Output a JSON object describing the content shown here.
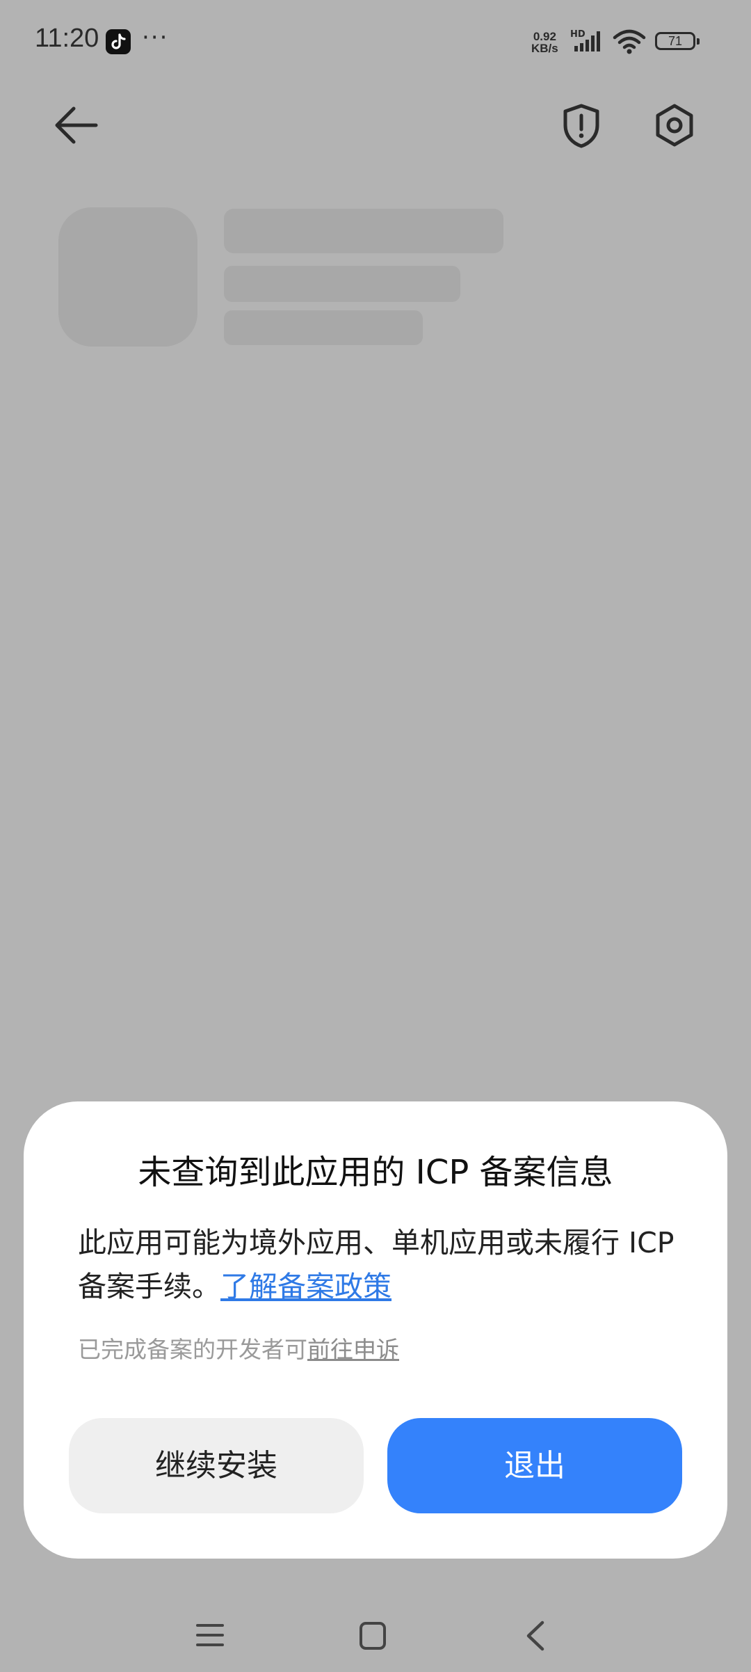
{
  "status_bar": {
    "time": "11:20",
    "more": "···",
    "net_speed_value": "0.92",
    "net_speed_unit": "KB/s",
    "hd": "HD",
    "battery": "71"
  },
  "dialog": {
    "title": "未查询到此应用的 ICP 备案信息",
    "body_text": "此应用可能为境外应用、单机应用或未履行 ICP 备案手续。",
    "body_link": "了解备案政策",
    "note_text": "已完成备案的开发者可",
    "note_link": "前往申诉",
    "continue_label": "继续安装",
    "exit_label": "退出"
  },
  "colors": {
    "overlay": "#b3b3b3",
    "primary": "#3482fb",
    "link": "#2f7ae6"
  }
}
